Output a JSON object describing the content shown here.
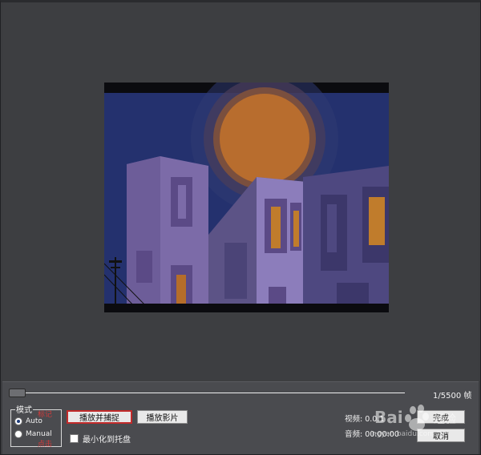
{
  "player": {
    "frame_counter": "1/5500 帧",
    "seek_progress": 0.0
  },
  "mode": {
    "title": "模式",
    "options": [
      {
        "label": "Auto",
        "selected": true
      },
      {
        "label": "Manual",
        "selected": false
      }
    ]
  },
  "buttons": {
    "play_capture": "播放并捕捉",
    "play_movie": "播放影片",
    "ok": "完成",
    "cancel": "取消"
  },
  "checkbox": {
    "minimize_to_tray": "最小化到托盘",
    "checked": false
  },
  "stats": {
    "video": "视频: 0.0.1",
    "audio": "音频: 00:00:00"
  },
  "annotations": {
    "mark_top": "标记",
    "mark_bottom": "点击"
  },
  "watermark": {
    "brand": "Bai 经验",
    "url": "jingyan.baidu.com"
  },
  "colors": {
    "background": "#3c3d40",
    "panel": "#4a4b4f",
    "accent_red": "#c22a2a"
  }
}
